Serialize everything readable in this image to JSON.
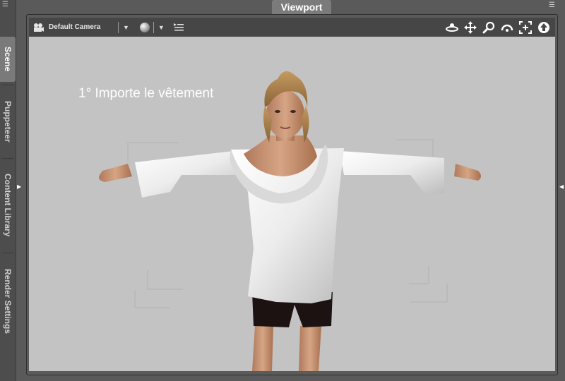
{
  "pane": {
    "title": "Viewport"
  },
  "side_tabs": [
    {
      "label": "Scene",
      "active": true
    },
    {
      "label": "Puppeteer",
      "active": false
    },
    {
      "label": "Content Library",
      "active": false
    },
    {
      "label": "Render Settings",
      "active": false
    }
  ],
  "toolbar": {
    "camera_label": "Default Camera",
    "camera_icon": "camera-icon",
    "draw_style_icon": "sphere-icon",
    "right_icons": [
      "orbit-icon",
      "pan-icon",
      "zoom-icon",
      "roll-icon",
      "frame-icon",
      "reset-view-icon"
    ]
  },
  "viewport": {
    "annotation": "1° Importe le vêtement",
    "background_color": "#c3c3c3"
  }
}
